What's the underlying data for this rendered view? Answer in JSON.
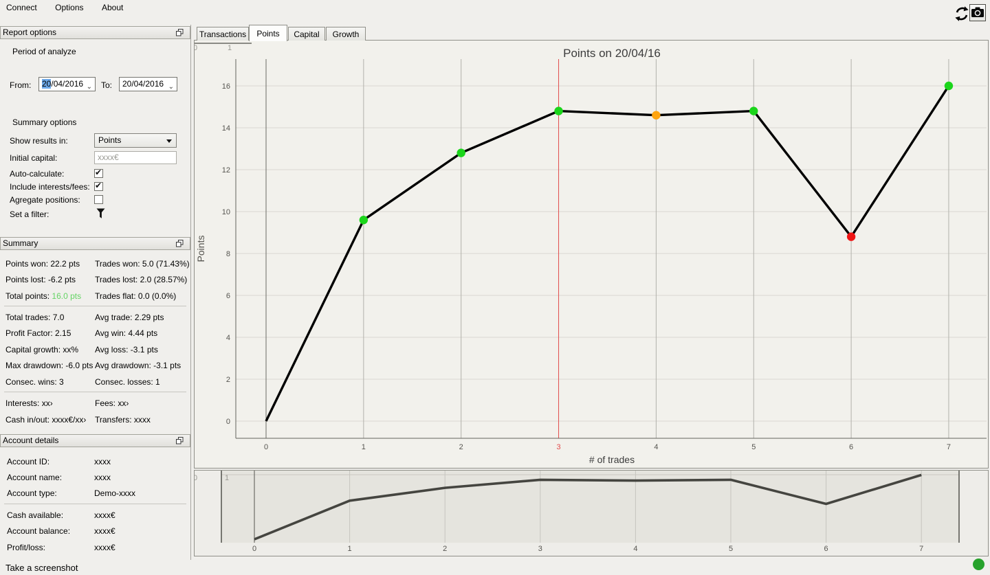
{
  "menu": {
    "items": [
      {
        "label": "Connect"
      },
      {
        "label": "Options"
      },
      {
        "label": "About"
      }
    ]
  },
  "toolbar": {
    "refresh_icon": "refresh-circular-arrows",
    "camera_icon": "camera-screenshot"
  },
  "tabs": [
    {
      "label": "Transactions",
      "active": false
    },
    {
      "label": "Points",
      "active": true
    },
    {
      "label": "Capital",
      "active": false
    },
    {
      "label": "Growth",
      "active": false
    }
  ],
  "panels": {
    "report_options": {
      "title": "Report options",
      "period_label": "Period of analyze",
      "from_label": "From:",
      "from_selected_part": "20",
      "from_rest": "/04/2016",
      "to_label": "To:",
      "to_value": "20/04/2016",
      "summary_options_label": "Summary options",
      "show_results_label": "Show results in:",
      "show_results_value": "Points",
      "initial_capital_label": "Initial capital:",
      "initial_capital_placeholder": "xxxx€",
      "auto_calculate_label": "Auto-calculate:",
      "auto_calculate_checked": true,
      "include_interests_label": "Include interests/fees:",
      "include_interests_checked": true,
      "aggregate_label": "Agregate positions:",
      "aggregate_checked": false,
      "filter_label": "Set a filter:",
      "filter_icon": "funnel-filter"
    },
    "summary": {
      "title": "Summary",
      "points_won": "Points won: 22.2 pts",
      "trades_won": "Trades won: 5.0 (71.43%)",
      "points_lost": "Points lost: -6.2 pts",
      "trades_lost": "Trades lost: 2.0 (28.57%)",
      "total_points_label": "Total points:",
      "total_points_value": "16.0 pts",
      "total_points_color": "#64d464",
      "trades_flat": "Trades flat: 0.0 (0.0%)",
      "total_trades": "Total trades: 7.0",
      "avg_trade": "Avg trade: 2.29 pts",
      "profit_factor": "Profit Factor: 2.15",
      "avg_win": "Avg win: 4.44 pts",
      "capital_growth": "Capital growth: xx%",
      "avg_loss": "Avg loss: -3.1 pts",
      "max_drawdown": "Max drawdown: -6.0 pts",
      "avg_drawdown": "Avg drawdown: -3.1 pts",
      "consec_wins": "Consec. wins: 3",
      "consec_losses": "Consec. losses: 1",
      "interests": "Interests: xx›",
      "fees": "Fees: xx›",
      "cash_in_out": "Cash in/out: xxxx€/xx›",
      "transfers": "Transfers: xxxx"
    },
    "account": {
      "title": "Account details",
      "rows": [
        {
          "label": "Account ID:",
          "value": "xxxx"
        },
        {
          "label": "Account name:",
          "value": "xxxx"
        },
        {
          "label": "Account type:",
          "value": "Demo-xxxx"
        },
        {
          "label": "Cash available:",
          "value": "xxxx€"
        },
        {
          "label": "Account balance:",
          "value": "xxxx€"
        },
        {
          "label": "Profit/loss:",
          "value": "xxxx€"
        }
      ]
    }
  },
  "chart_data": {
    "type": "line",
    "title": "Points on 20/04/16",
    "xlabel": "# of trades",
    "ylabel": "Points",
    "x": [
      0,
      1,
      2,
      3,
      4,
      5,
      6,
      7
    ],
    "y": [
      0.0,
      9.6,
      12.8,
      14.8,
      14.6,
      14.8,
      8.8,
      16.0
    ],
    "point_colors": [
      null,
      "#1bd51b",
      "#1bd51b",
      "#1bd51b",
      "#ffa40f",
      "#1bd51b",
      "#ef1515",
      "#1bd51b"
    ],
    "line_color": "#000000",
    "xticks": [
      0,
      1,
      2,
      3,
      4,
      5,
      6,
      7
    ],
    "yticks": [
      0,
      2,
      4,
      6,
      8,
      10,
      12,
      14,
      16
    ],
    "ylim": [
      0,
      17.3
    ],
    "xlim": [
      -0.3,
      7.4
    ],
    "grid": true,
    "legend": false,
    "highlight_xtick": 3,
    "highlight_color": "#e14b4b",
    "mini_axis_labels": [
      "0",
      "1"
    ],
    "overview": {
      "line_color": "#454540",
      "same_series": true
    }
  },
  "status": {
    "screenshot_label": "Take a screenshot",
    "connection_color": "#27a22c",
    "connection_icon": "green-status-dot"
  }
}
